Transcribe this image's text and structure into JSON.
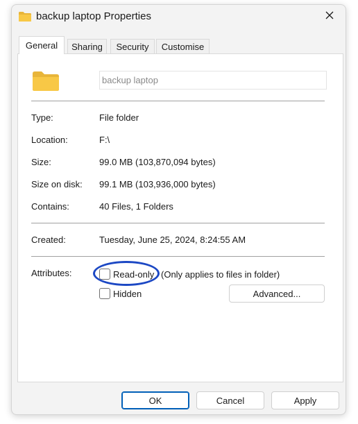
{
  "window": {
    "title": "backup laptop Properties",
    "icons": {
      "title_icon": "folder-icon",
      "close_icon": "close-icon",
      "big_icon": "folder-icon"
    }
  },
  "tabs": [
    {
      "label": "General",
      "active": true
    },
    {
      "label": "Sharing",
      "active": false
    },
    {
      "label": "Security",
      "active": false
    },
    {
      "label": "Customise",
      "active": false
    }
  ],
  "general": {
    "name_value": "backup laptop",
    "properties": [
      {
        "label": "Type:",
        "value": "File folder"
      },
      {
        "label": "Location:",
        "value": "F:\\"
      },
      {
        "label": "Size:",
        "value": "99.0 MB (103,870,094 bytes)"
      },
      {
        "label": "Size on disk:",
        "value": "99.1 MB (103,936,000 bytes)"
      },
      {
        "label": "Contains:",
        "value": "40 Files, 1 Folders"
      }
    ],
    "created": {
      "label": "Created:",
      "value": "Tuesday, June 25, 2024, 8:24:55 AM"
    },
    "attributes": {
      "label": "Attributes:",
      "readonly_label": "Read-only",
      "readonly_note": "(Only applies to files in folder)",
      "readonly_checked": false,
      "hidden_label": "Hidden",
      "hidden_checked": false,
      "advanced_label": "Advanced..."
    }
  },
  "buttons": {
    "ok": "OK",
    "cancel": "Cancel",
    "apply": "Apply"
  },
  "colors": {
    "accent": "#005fb8",
    "annotation": "#1c48c4",
    "folder": "#f8c846"
  }
}
